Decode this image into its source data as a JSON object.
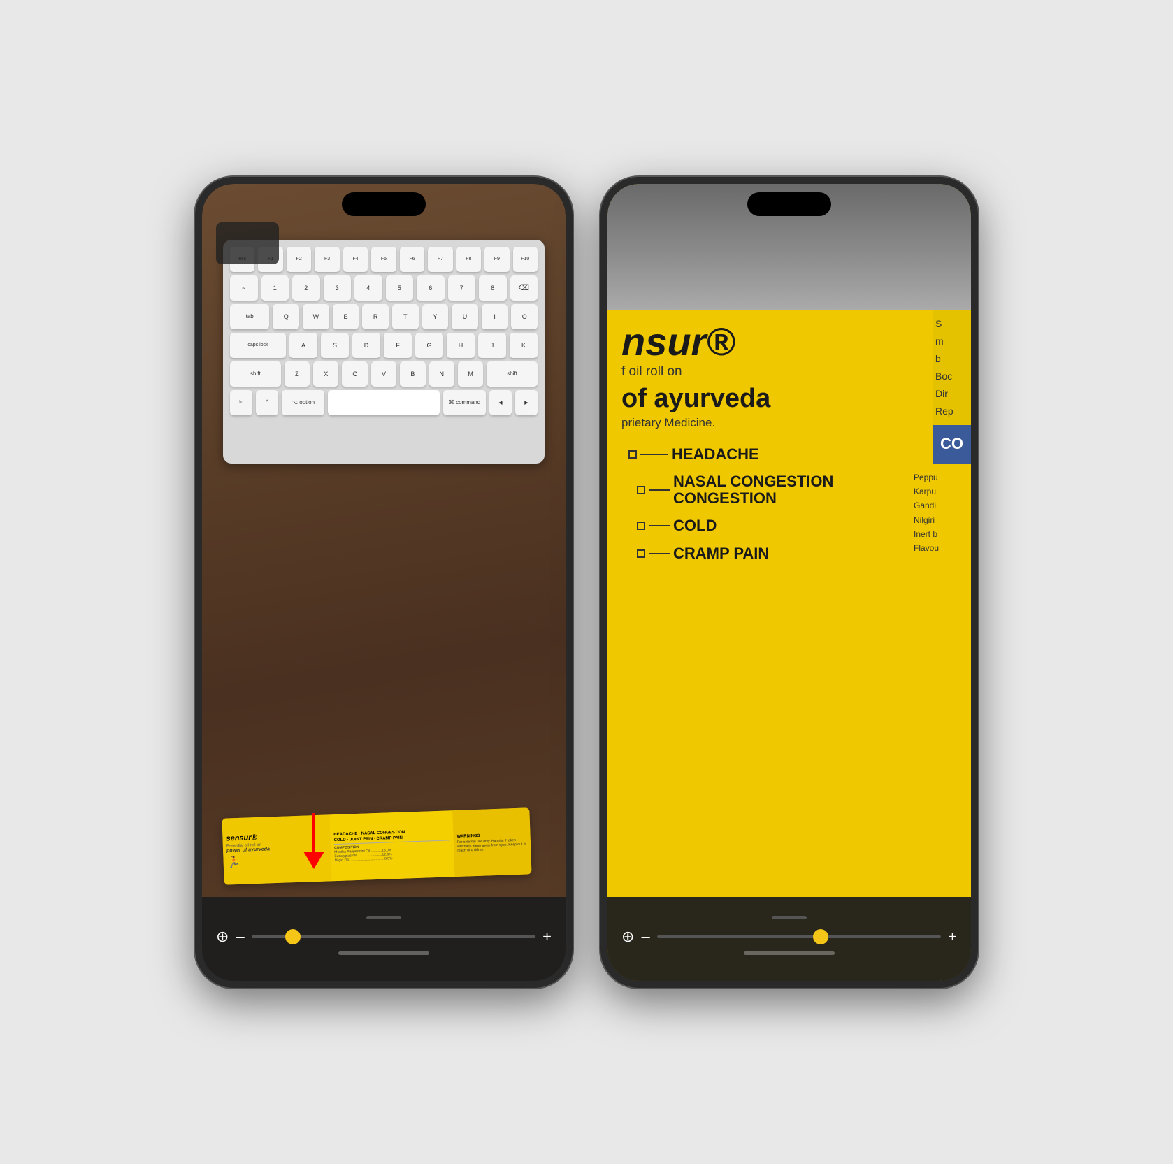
{
  "page": {
    "background": "#e8e8e8"
  },
  "phone1": {
    "label": "phone-left",
    "keyboard": {
      "rows": [
        [
          "esc",
          "F1",
          "F2",
          "F3",
          "F4",
          "F5",
          "F6"
        ],
        [
          "~",
          "1",
          "2",
          "3",
          "4",
          "5",
          "6",
          "7"
        ],
        [
          "tab",
          "Q",
          "W",
          "E",
          "R",
          "T",
          "Y"
        ],
        [
          "caps lock",
          "A",
          "S",
          "D",
          "F",
          "G",
          "H"
        ],
        [
          "shift",
          "Z",
          "X",
          "C",
          "V",
          "B"
        ],
        [
          "fn",
          "^",
          "⌥ option",
          "⌘ command"
        ]
      ]
    },
    "product": {
      "brand": "sensur®",
      "tagline": "power of ayurveda",
      "description": "Essential oil roll on"
    },
    "zoom": {
      "min_label": "–",
      "max_label": "+",
      "thumb_position": "12%"
    },
    "arrow": {
      "color": "red",
      "direction": "down"
    }
  },
  "phone2": {
    "label": "phone-right",
    "label_content": {
      "brand": "nsur®",
      "oil_type": "f oil roll on",
      "system": "of ayurveda",
      "medicine_type": "prietary Medicine.",
      "symptoms": [
        "HEADACHE",
        "NASAL CONGESTION",
        "COLD",
        "CRAMP PAIN"
      ],
      "right_partial": [
        "S",
        "m",
        "b",
        "Boc",
        "Dir",
        "Rep"
      ],
      "blue_box_text": "CO",
      "ingredients": [
        "Peppu",
        "Karpu",
        "Gandi",
        "Nilgiri",
        "Inert b",
        "Flavou"
      ]
    },
    "zoom": {
      "min_label": "–",
      "max_label": "+",
      "thumb_position": "55%"
    }
  }
}
